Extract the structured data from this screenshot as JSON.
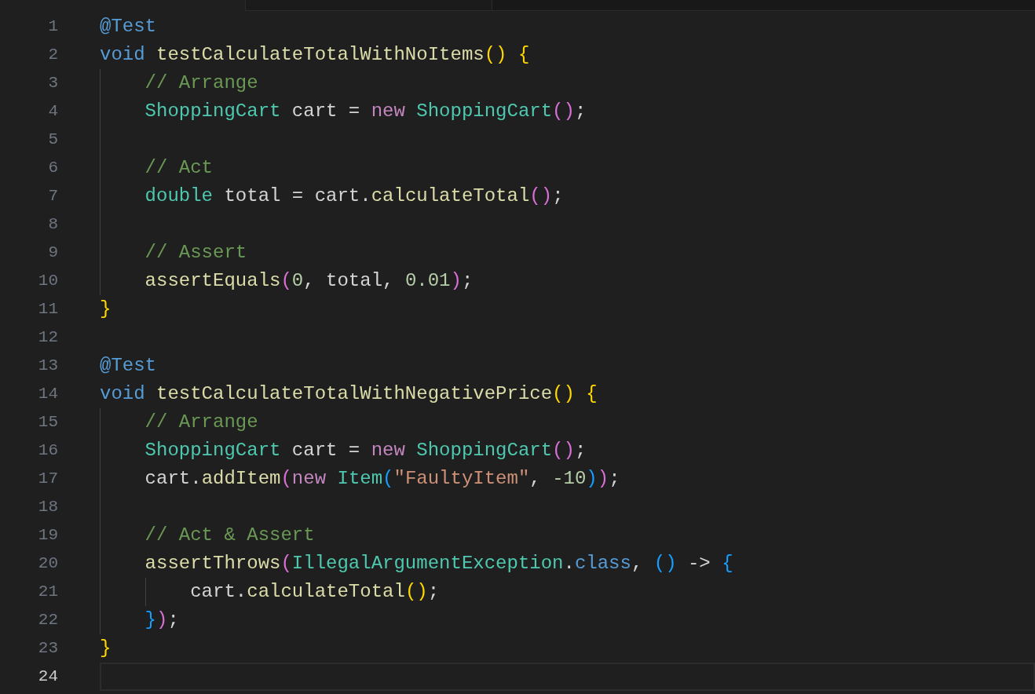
{
  "lines": [
    {
      "number": "1",
      "current": false,
      "tokens": [
        {
          "text": "@Test",
          "kind": "keyword"
        }
      ]
    },
    {
      "number": "2",
      "current": false,
      "tokens": [
        {
          "text": "void",
          "kind": "keyword"
        },
        {
          "text": " testCalculateTotalWithNoItems",
          "kind": "func"
        },
        {
          "text": "()",
          "kind": "bracket1"
        },
        {
          "text": " {",
          "kind": "bracket1"
        }
      ]
    },
    {
      "number": "3",
      "current": false,
      "tokens": [
        {
          "text": "    // Arrange",
          "kind": "comment"
        }
      ]
    },
    {
      "number": "4",
      "current": false,
      "tokens": [
        {
          "text": "    ShoppingCart",
          "kind": "type"
        },
        {
          "text": " cart = ",
          "kind": "plain"
        },
        {
          "text": "new",
          "kind": "control"
        },
        {
          "text": " ShoppingCart",
          "kind": "type"
        },
        {
          "text": "()",
          "kind": "bracket2"
        },
        {
          "text": ";",
          "kind": "plain"
        }
      ]
    },
    {
      "number": "5",
      "current": false
    },
    {
      "number": "6",
      "current": false,
      "tokens": [
        {
          "text": "    // Act",
          "kind": "comment"
        }
      ]
    },
    {
      "number": "7",
      "current": false,
      "tokens": [
        {
          "text": "    double",
          "kind": "type"
        },
        {
          "text": " total = cart.",
          "kind": "plain"
        },
        {
          "text": "calculateTotal",
          "kind": "func"
        },
        {
          "text": "()",
          "kind": "bracket2"
        },
        {
          "text": ";",
          "kind": "plain"
        }
      ]
    },
    {
      "number": "8",
      "current": false
    },
    {
      "number": "9",
      "current": false,
      "tokens": [
        {
          "text": "    // Assert",
          "kind": "comment"
        }
      ]
    },
    {
      "number": "10",
      "current": false,
      "tokens": [
        {
          "text": "    assertEquals",
          "kind": "func"
        },
        {
          "text": "(",
          "kind": "bracket2"
        },
        {
          "text": "0",
          "kind": "number"
        },
        {
          "text": ", total, ",
          "kind": "plain"
        },
        {
          "text": "0.01",
          "kind": "number"
        },
        {
          "text": ")",
          "kind": "bracket2"
        },
        {
          "text": ";",
          "kind": "plain"
        }
      ]
    },
    {
      "number": "11",
      "current": false,
      "tokens": [
        {
          "text": "}",
          "kind": "bracket1"
        }
      ]
    },
    {
      "number": "12",
      "current": false
    },
    {
      "number": "13",
      "current": false,
      "tokens": [
        {
          "text": "@Test",
          "kind": "keyword"
        }
      ]
    },
    {
      "number": "14",
      "current": false,
      "tokens": [
        {
          "text": "void",
          "kind": "keyword"
        },
        {
          "text": " testCalculateTotalWithNegativePrice",
          "kind": "func"
        },
        {
          "text": "()",
          "kind": "bracket1"
        },
        {
          "text": " {",
          "kind": "bracket1"
        }
      ]
    },
    {
      "number": "15",
      "current": false,
      "tokens": [
        {
          "text": "    // Arrange",
          "kind": "comment"
        }
      ]
    },
    {
      "number": "16",
      "current": false,
      "tokens": [
        {
          "text": "    ShoppingCart",
          "kind": "type"
        },
        {
          "text": " cart = ",
          "kind": "plain"
        },
        {
          "text": "new",
          "kind": "control"
        },
        {
          "text": " ShoppingCart",
          "kind": "type"
        },
        {
          "text": "()",
          "kind": "bracket2"
        },
        {
          "text": ";",
          "kind": "plain"
        }
      ]
    },
    {
      "number": "17",
      "current": false,
      "tokens": [
        {
          "text": "    cart.",
          "kind": "plain"
        },
        {
          "text": "addItem",
          "kind": "func"
        },
        {
          "text": "(",
          "kind": "bracket2"
        },
        {
          "text": "new",
          "kind": "control"
        },
        {
          "text": " Item",
          "kind": "type"
        },
        {
          "text": "(",
          "kind": "bracket3"
        },
        {
          "text": "\"FaultyItem\"",
          "kind": "string"
        },
        {
          "text": ", ",
          "kind": "plain"
        },
        {
          "text": "-10",
          "kind": "number"
        },
        {
          "text": ")",
          "kind": "bracket3"
        },
        {
          "text": ")",
          "kind": "bracket2"
        },
        {
          "text": ";",
          "kind": "plain"
        }
      ]
    },
    {
      "number": "18",
      "current": false
    },
    {
      "number": "19",
      "current": false,
      "tokens": [
        {
          "text": "    // Act & Assert",
          "kind": "comment"
        }
      ]
    },
    {
      "number": "20",
      "current": false,
      "tokens": [
        {
          "text": "    assertThrows",
          "kind": "func"
        },
        {
          "text": "(",
          "kind": "bracket2"
        },
        {
          "text": "IllegalArgumentException",
          "kind": "type"
        },
        {
          "text": ".",
          "kind": "plain"
        },
        {
          "text": "class",
          "kind": "keyword"
        },
        {
          "text": ", ",
          "kind": "plain"
        },
        {
          "text": "()",
          "kind": "bracket3"
        },
        {
          "text": " -> ",
          "kind": "plain"
        },
        {
          "text": "{",
          "kind": "bracket3"
        }
      ]
    },
    {
      "number": "21",
      "current": false,
      "tokens": [
        {
          "text": "        cart.",
          "kind": "plain"
        },
        {
          "text": "calculateTotal",
          "kind": "func"
        },
        {
          "text": "()",
          "kind": "bracket1"
        },
        {
          "text": ";",
          "kind": "plain"
        }
      ]
    },
    {
      "number": "22",
      "current": false,
      "tokens": [
        {
          "text": "    }",
          "kind": "bracket3"
        },
        {
          "text": ")",
          "kind": "bracket2"
        },
        {
          "text": ";",
          "kind": "plain"
        }
      ]
    },
    {
      "number": "23",
      "current": false,
      "tokens": [
        {
          "text": "}",
          "kind": "bracket1"
        }
      ]
    },
    {
      "number": "24",
      "current": true
    }
  ]
}
